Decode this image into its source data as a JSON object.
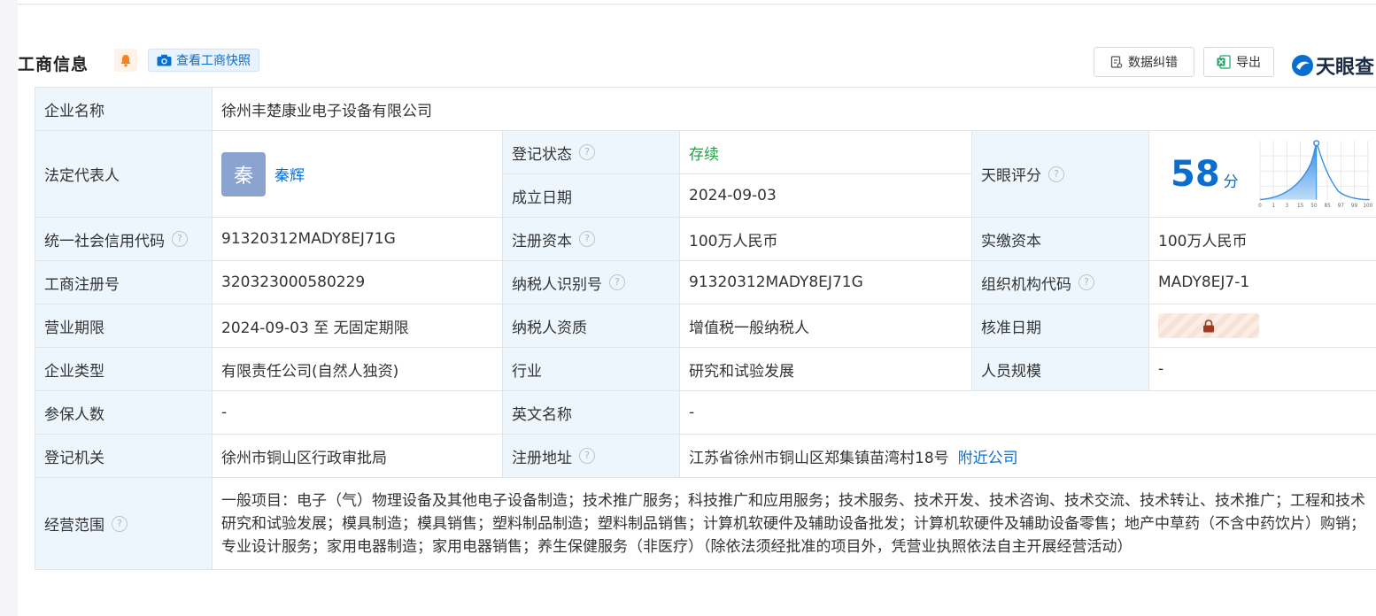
{
  "header": {
    "title": "工商信息",
    "snapshot_label": "查看工商快照",
    "correct_label": "数据纠错",
    "export_label": "导出",
    "logo_text": "天眼查"
  },
  "colors": {
    "accent": "#0a6ed1",
    "label_bg": "#eef6fd",
    "status_green": "#27a04a",
    "bell_orange": "#f5821f"
  },
  "info": {
    "company_name_label": "企业名称",
    "company_name": "徐州丰楚康业电子设备有限公司",
    "legal_rep_label": "法定代表人",
    "legal_rep_avatar": "秦",
    "legal_rep_name": "秦辉",
    "status_label": "登记状态",
    "status": "存续",
    "founded_label": "成立日期",
    "founded": "2024-09-03",
    "score_label": "天眼评分",
    "score": "58",
    "score_unit": "分",
    "score_ticks": [
      "0",
      "1",
      "3",
      "15",
      "50",
      "85",
      "97",
      "99",
      "100"
    ],
    "credit_code_label": "统一社会信用代码",
    "credit_code": "91320312MADY8EJ71G",
    "reg_capital_label": "注册资本",
    "reg_capital": "100万人民币",
    "paid_capital_label": "实缴资本",
    "paid_capital": "100万人民币",
    "reg_no_label": "工商注册号",
    "reg_no": "320323000580229",
    "taxpayer_id_label": "纳税人识别号",
    "taxpayer_id": "91320312MADY8EJ71G",
    "org_code_label": "组织机构代码",
    "org_code": "MADY8EJ7-1",
    "term_label": "营业期限",
    "term": "2024-09-03 至 无固定期限",
    "taxpayer_qual_label": "纳税人资质",
    "taxpayer_qual": "增值税一般纳税人",
    "approval_label": "核准日期",
    "type_label": "企业类型",
    "type": "有限责任公司(自然人独资)",
    "industry_label": "行业",
    "industry": "研究和试验发展",
    "staff_label": "人员规模",
    "staff": "-",
    "insured_label": "参保人数",
    "insured": "-",
    "english_label": "英文名称",
    "english": "-",
    "authority_label": "登记机关",
    "authority": "徐州市铜山区行政审批局",
    "address_label": "注册地址",
    "address": "江苏省徐州市铜山区郑集镇苗湾村18号",
    "nearby_label": "附近公司",
    "scope_label": "经营范围",
    "scope": "一般项目：电子（气）物理设备及其他电子设备制造；技术推广服务；科技推广和应用服务；技术服务、技术开发、技术咨询、技术交流、技术转让、技术推广；工程和技术研究和试验发展；模具制造；模具销售；塑料制品制造；塑料制品销售；计算机软硬件及辅助设备批发；计算机软硬件及辅助设备零售；地产中草药（不含中药饮片）购销；专业设计服务；家用电器制造；家用电器销售；养生保健服务（非医疗）（除依法须经批准的项目外，凭营业执照依法自主开展经营活动）"
  }
}
